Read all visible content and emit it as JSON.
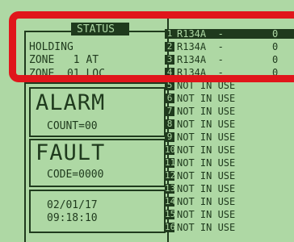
{
  "status_panel": {
    "title": "STATUS",
    "line1": "HOLDING",
    "line2": "ZONE   1 AT",
    "line3": "ZONE  01 LOC"
  },
  "alarm_panel": {
    "title": "ALARM",
    "count": "COUNT=00"
  },
  "fault_panel": {
    "title": "FAULT",
    "code": "CODE=0000"
  },
  "datetime_panel": {
    "date": "02/01/17",
    "time": "09:18:10"
  },
  "zones": [
    {
      "num": "1",
      "label": "R134A  -",
      "value": "0",
      "selected": true
    },
    {
      "num": "2",
      "label": "R134A  -",
      "value": "0"
    },
    {
      "num": "3",
      "label": "R134A  -",
      "value": "0"
    },
    {
      "num": "4",
      "label": "R134A  -",
      "value": "0"
    },
    {
      "num": "5",
      "label": "NOT IN USE",
      "value": ""
    },
    {
      "num": "6",
      "label": "NOT IN USE",
      "value": ""
    },
    {
      "num": "7",
      "label": "NOT IN USE",
      "value": ""
    },
    {
      "num": "8",
      "label": "NOT IN USE",
      "value": ""
    },
    {
      "num": "9",
      "label": "NOT IN USE",
      "value": ""
    },
    {
      "num": "10",
      "label": "NOT IN USE",
      "value": ""
    },
    {
      "num": "11",
      "label": "NOT IN USE",
      "value": ""
    },
    {
      "num": "12",
      "label": "NOT IN USE",
      "value": ""
    },
    {
      "num": "13",
      "label": "NOT IN USE",
      "value": ""
    },
    {
      "num": "14",
      "label": "NOT IN USE",
      "value": ""
    },
    {
      "num": "15",
      "label": "NOT IN USE",
      "value": ""
    },
    {
      "num": "16",
      "label": "NOT IN USE",
      "value": ""
    }
  ],
  "colors": {
    "lcd_background": "#aed8a4",
    "lcd_ink": "#1f3a1d",
    "highlight": "#e0161b"
  }
}
